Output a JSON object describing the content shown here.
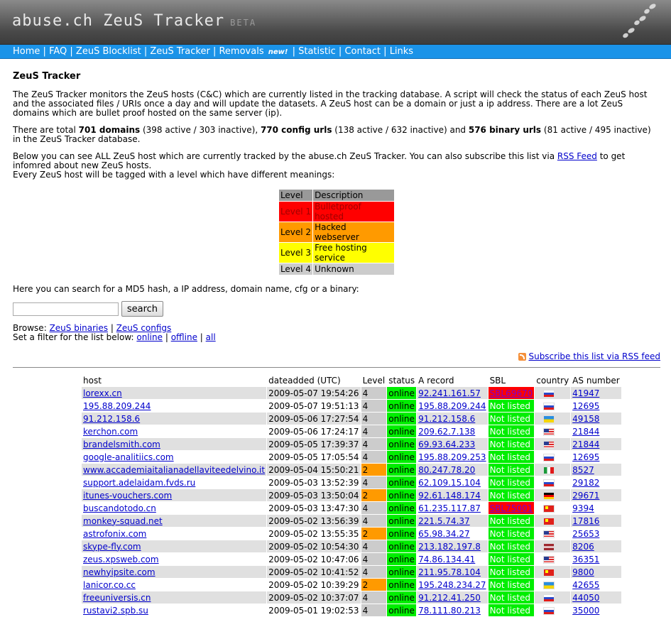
{
  "site": {
    "title": "abuse.ch ZeuS Tracker",
    "badge": "BETA"
  },
  "nav": {
    "home": "Home",
    "faq": "FAQ",
    "blocklist": "ZeuS Blocklist",
    "tracker": "ZeuS Tracker",
    "removals": "Removals",
    "removals_badge": "new!",
    "statistic": "Statistic",
    "contact": "Contact",
    "links": "Links",
    "sep": "|"
  },
  "content": {
    "heading": "ZeuS Tracker",
    "intro": "The ZeuS Tracker monitors the ZeuS hosts (C&C) which are currently listed in the tracking database. A script will check the status of each ZeuS host and the associated files / URIs once a day and will update the datasets. A ZeuS host can be a domain or just a ip address. There are a lot ZeuS domains which are bullet proof hosted on the same server (ip).",
    "stats": {
      "prefix": "There are total ",
      "domains": "701 domains",
      "domains_detail": " (398 active / 303 inactive), ",
      "configs": "770 config urls",
      "configs_detail": " (138 active / 632 inactive) and ",
      "binaries": "576 binary urls",
      "binaries_detail": " (81 active / 495 inactive) in the ZeuS Tracker database."
    },
    "below_1": "Below you can see ALL ZeuS host which are currently tracked by the abuse.ch ZeuS Tracker. You can also subscribe this list via ",
    "rss_feed": "RSS Feed",
    "below_2": " to get infomred about new ZeuS hosts.",
    "levels_intro": "Every ZeuS host will be tagged with a level which have different meanings:",
    "search_intro": "Here you can search for a MD5 hash, a IP address, domain name, cfg or a binary:",
    "search_placeholder": "",
    "search_button": "search",
    "browse_label": "Browse: ",
    "browse_binaries": "ZeuS binaries",
    "browse_sep": " | ",
    "browse_configs": "ZeuS configs",
    "filter_label": "Set a filter for the list below: ",
    "filter_online": "online",
    "filter_offline": "offline",
    "filter_all": "all",
    "subscribe": "Subscribe this list via RSS feed"
  },
  "legend": {
    "head_level": "Level",
    "head_desc": "Description",
    "rows": [
      {
        "level": "Level 1",
        "desc": "Bulletproof hosted",
        "color": "#ff0000",
        "text": "#a00000"
      },
      {
        "level": "Level 2",
        "desc": "Hacked webserver",
        "color": "#ff9a00",
        "text": "#000000"
      },
      {
        "level": "Level 3",
        "desc": "Free hosting service",
        "color": "#ffff00",
        "text": "#000000"
      },
      {
        "level": "Level 4",
        "desc": "Unknown",
        "color": "#cccccc",
        "text": "#000000"
      }
    ]
  },
  "table": {
    "headers": {
      "host": "host",
      "dateadded": "dateadded (UTC)",
      "level": "Level",
      "status": "status",
      "arecord": "A record",
      "sbl": "SBL",
      "country": "country",
      "asn": "AS number"
    },
    "rows": [
      {
        "host": "lorexx.cn",
        "date": "2009-05-07 19:54:26",
        "level": "4",
        "status": "online",
        "a": "92.241.161.57",
        "sbl": "SBL69670",
        "sbl_listed": true,
        "country": "ru",
        "asn": "41947"
      },
      {
        "host": "195.88.209.244",
        "date": "2009-05-07 19:51:13",
        "level": "4",
        "status": "online",
        "a": "195.88.209.244",
        "sbl": "Not listed",
        "sbl_listed": false,
        "country": "ru",
        "asn": "12695"
      },
      {
        "host": "91.212.158.6",
        "date": "2009-05-06 17:27:54",
        "level": "4",
        "status": "online",
        "a": "91.212.158.6",
        "sbl": "Not listed",
        "sbl_listed": false,
        "country": "ua",
        "asn": "49158"
      },
      {
        "host": "kerchon.com",
        "date": "2009-05-06 17:24:17",
        "level": "4",
        "status": "online",
        "a": "209.62.7.138",
        "sbl": "Not listed",
        "sbl_listed": false,
        "country": "us",
        "asn": "21844"
      },
      {
        "host": "brandelsmith.com",
        "date": "2009-05-05 17:39:37",
        "level": "4",
        "status": "online",
        "a": "69.93.64.233",
        "sbl": "Not listed",
        "sbl_listed": false,
        "country": "us",
        "asn": "21844"
      },
      {
        "host": "google-analitiics.com",
        "date": "2009-05-05 17:05:54",
        "level": "4",
        "status": "online",
        "a": "195.88.209.253",
        "sbl": "Not listed",
        "sbl_listed": false,
        "country": "ru",
        "asn": "12695"
      },
      {
        "host": "www.accademiaitalianadellaviteedelvino.it",
        "date": "2009-05-04 15:50:21",
        "level": "2",
        "status": "online",
        "a": "80.247.78.20",
        "sbl": "Not listed",
        "sbl_listed": false,
        "country": "it",
        "asn": "8527"
      },
      {
        "host": "support.adelaidam.fvds.ru",
        "date": "2009-05-03 13:52:39",
        "level": "4",
        "status": "online",
        "a": "62.109.15.104",
        "sbl": "Not listed",
        "sbl_listed": false,
        "country": "ru",
        "asn": "29182"
      },
      {
        "host": "itunes-vouchers.com",
        "date": "2009-05-03 13:50:04",
        "level": "2",
        "status": "online",
        "a": "92.61.148.174",
        "sbl": "Not listed",
        "sbl_listed": false,
        "country": "de",
        "asn": "29671"
      },
      {
        "host": "buscandotodo.cn",
        "date": "2009-05-03 13:47:30",
        "level": "4",
        "status": "online",
        "a": "61.235.117.87",
        "sbl": "SBL75001",
        "sbl_listed": true,
        "country": "cn",
        "asn": "9394"
      },
      {
        "host": "monkey-squad.net",
        "date": "2009-05-02 13:56:39",
        "level": "4",
        "status": "online",
        "a": "221.5.74.37",
        "sbl": "Not listed",
        "sbl_listed": false,
        "country": "cn",
        "asn": "17816"
      },
      {
        "host": "astrofonix.com",
        "date": "2009-05-02 13:55:35",
        "level": "2",
        "status": "online",
        "a": "65.98.34.27",
        "sbl": "Not listed",
        "sbl_listed": false,
        "country": "us",
        "asn": "25653"
      },
      {
        "host": "skype-fly.com",
        "date": "2009-05-02 10:54:30",
        "level": "4",
        "status": "online",
        "a": "213.182.197.8",
        "sbl": "Not listed",
        "sbl_listed": false,
        "country": "lv",
        "asn": "8206"
      },
      {
        "host": "zeus.xpsweb.com",
        "date": "2009-05-02 10:47:06",
        "level": "4",
        "status": "online",
        "a": "74.86.134.41",
        "sbl": "Not listed",
        "sbl_listed": false,
        "country": "us",
        "asn": "36351"
      },
      {
        "host": "newhyipsite.com",
        "date": "2009-05-02 10:41:52",
        "level": "4",
        "status": "online",
        "a": "211.95.78.104",
        "sbl": "Not listed",
        "sbl_listed": false,
        "country": "cn",
        "asn": "9800"
      },
      {
        "host": "lanicor.co.cc",
        "date": "2009-05-02 10:39:29",
        "level": "2",
        "status": "online",
        "a": "195.248.234.27",
        "sbl": "Not listed",
        "sbl_listed": false,
        "country": "ua",
        "asn": "42655"
      },
      {
        "host": "freeuniversis.cn",
        "date": "2009-05-02 10:37:07",
        "level": "4",
        "status": "online",
        "a": "91.212.41.250",
        "sbl": "Not listed",
        "sbl_listed": false,
        "country": "ru",
        "asn": "44050"
      },
      {
        "host": "rustavi2.spb.su",
        "date": "2009-05-01 19:02:53",
        "level": "4",
        "status": "online",
        "a": "78.111.80.213",
        "sbl": "Not listed",
        "sbl_listed": false,
        "country": "ru",
        "asn": "35000"
      }
    ]
  }
}
